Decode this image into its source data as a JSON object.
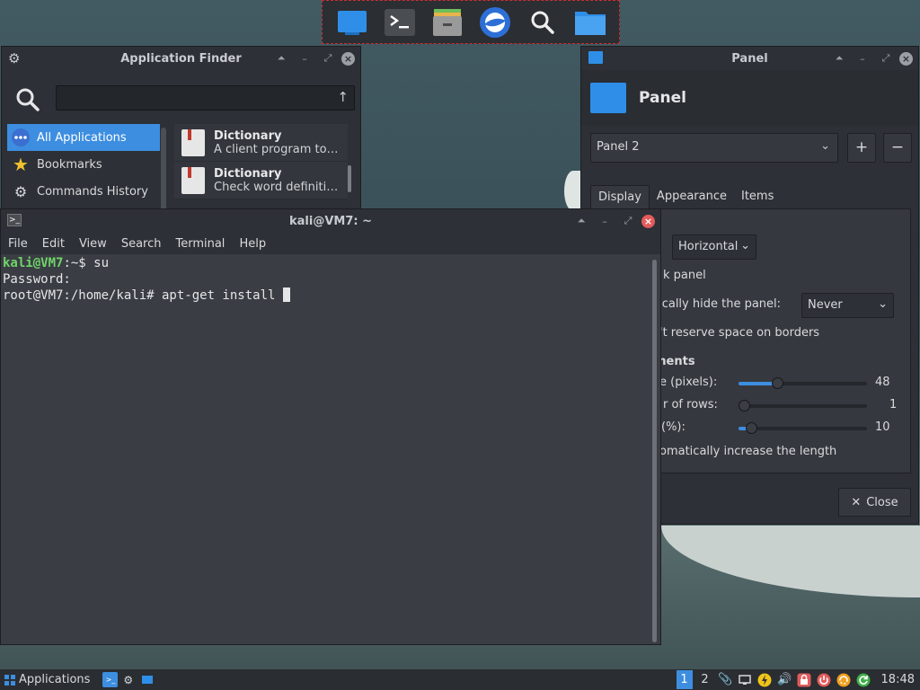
{
  "finder": {
    "title": "Application Finder",
    "search_value": "",
    "categories": [
      {
        "label": "All Applications",
        "selected": true
      },
      {
        "label": "Bookmarks",
        "selected": false
      },
      {
        "label": "Commands History",
        "selected": false
      }
    ],
    "apps": [
      {
        "name": "Dictionary",
        "desc": "A client program to…"
      },
      {
        "name": "Dictionary",
        "desc": "Check word definiti…"
      }
    ]
  },
  "panel": {
    "title": "Panel",
    "header": "Panel",
    "selected_panel": "Panel 2",
    "add_label": "+",
    "remove_label": "−",
    "tabs": [
      "Display",
      "Appearance",
      "Items"
    ],
    "mode_value": "Horizontal",
    "lock_label": "k panel",
    "autohide_label": "tically hide the panel:",
    "autohide_value": "Never",
    "reserve_label": "'t reserve space on borders",
    "section_label": "ments",
    "size_label": "e (pixels):",
    "size_value": "48",
    "size_fraction": 0.3,
    "rows_label": "r of rows:",
    "rows_value": "1",
    "rows_fraction": 0.0,
    "length_label": "(%):",
    "length_value": "10",
    "length_fraction": 0.1,
    "autolength_label": "omatically increase the length",
    "close_label": "Close"
  },
  "terminal": {
    "title": "kali@VM7: ~",
    "menu": [
      "File",
      "Edit",
      "View",
      "Search",
      "Terminal",
      "Help"
    ],
    "line1_prompt_user": "kali@VM7",
    "line1_prompt_rest": ":~$ ",
    "line1_cmd": "su",
    "line2": "Password:",
    "line3": "root@VM7:/home/kali# apt-get install "
  },
  "taskbar": {
    "apps_label": "Applications",
    "workspaces": [
      "1",
      "2"
    ],
    "clock": "18:48"
  },
  "colors": {
    "accent": "#3d8ee0",
    "prompt_green": "#6fd46a",
    "close_red": "#e35b5b"
  }
}
